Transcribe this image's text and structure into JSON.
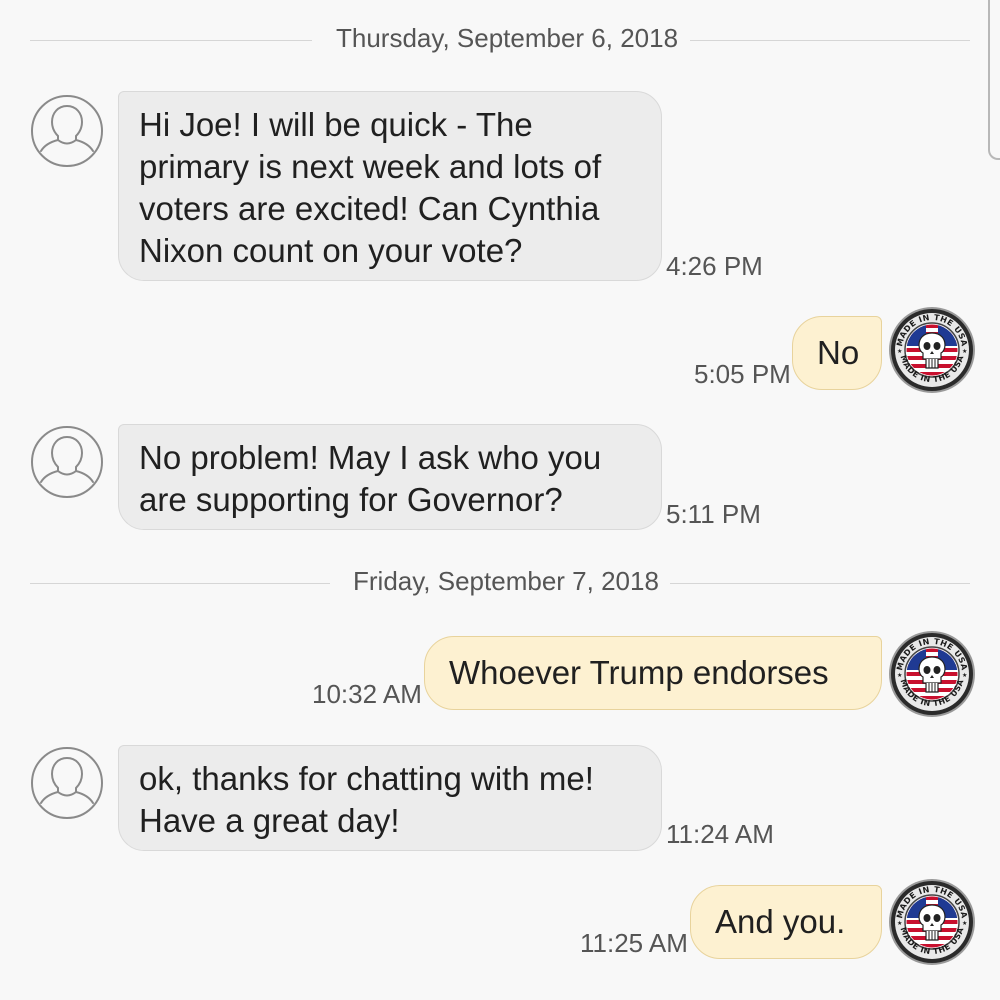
{
  "conversation": {
    "date_separators": [
      "Thursday, September 6, 2018",
      "Friday, September 7, 2018"
    ],
    "messages": [
      {
        "direction": "incoming",
        "text": "Hi Joe! I will be quick - The primary is next week and lots of voters are excited! Can Cynthia Nixon count on your vote?",
        "time": "4:26 PM"
      },
      {
        "direction": "outgoing",
        "text": "No",
        "time": "5:05 PM"
      },
      {
        "direction": "incoming",
        "text": "No problem! May I ask who you are supporting for Governor?",
        "time": "5:11 PM"
      },
      {
        "direction": "outgoing",
        "text": "Whoever Trump endorses",
        "time": "10:32 AM"
      },
      {
        "direction": "incoming",
        "text": "ok, thanks for chatting with me! Have a great day!",
        "time": "11:24 AM"
      },
      {
        "direction": "outgoing",
        "text": "And you.",
        "time": "11:25 AM"
      }
    ],
    "sender_avatar_icon": "default-person-icon",
    "user_avatar_badge": {
      "icon": "usa-flag-skull-badge-icon",
      "text": "MADE IN THE USA"
    }
  },
  "colors": {
    "background": "#f8f8f8",
    "incoming_bubble": "#ececec",
    "outgoing_bubble": "#fdf1d1",
    "outgoing_border": "#e8d39c",
    "flag_red": "#c8102e",
    "flag_blue": "#1f3a93"
  }
}
